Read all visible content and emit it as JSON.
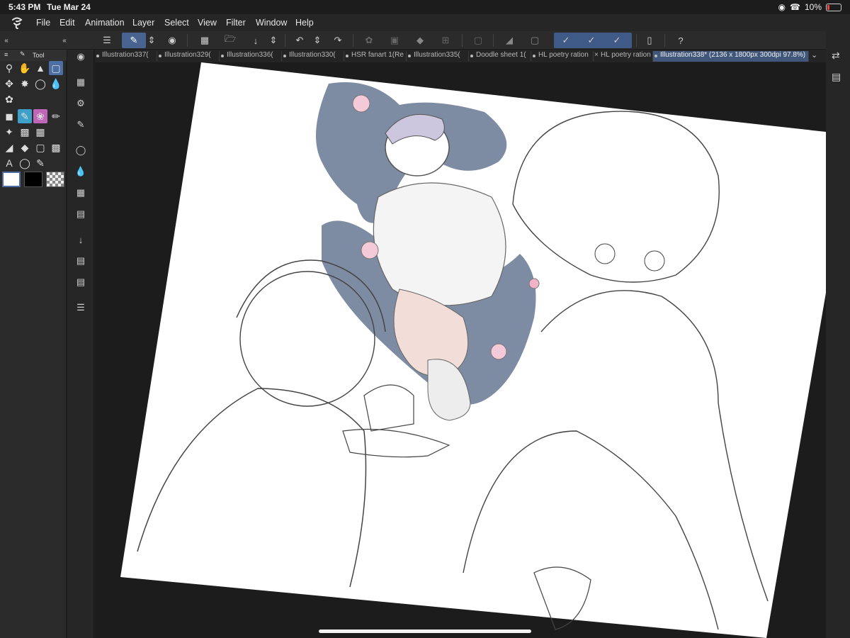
{
  "status_bar": {
    "time": "5:43 PM",
    "date": "Tue Mar 24",
    "battery": "10%"
  },
  "menu": {
    "items": [
      "File",
      "Edit",
      "Animation",
      "Layer",
      "Select",
      "View",
      "Filter",
      "Window",
      "Help"
    ]
  },
  "tool_panel": {
    "title": "Tool"
  },
  "tabs": [
    "Illustration337(",
    "Illustration329(",
    "Illustration336(",
    "Illustration330(",
    "HSR fanart 1(Re",
    "Illustration335(",
    "Doodle sheet 1(",
    "HL poetry ration",
    "HL poetry ration",
    "Illustration338* (2136 x 1800px 300dpi 97.8%)"
  ],
  "active_tab_index": 9,
  "colors": {
    "accent": "#4b6ea4",
    "main_color": "#ffffff",
    "sub_color": "#000000",
    "canvas_bg": "#1c1c1c",
    "artwork_fill": "#7d8ba3"
  },
  "icons": {
    "menu": "hamburger-icon",
    "undo": "undo-icon",
    "redo": "redo-icon",
    "search": "search-icon"
  }
}
